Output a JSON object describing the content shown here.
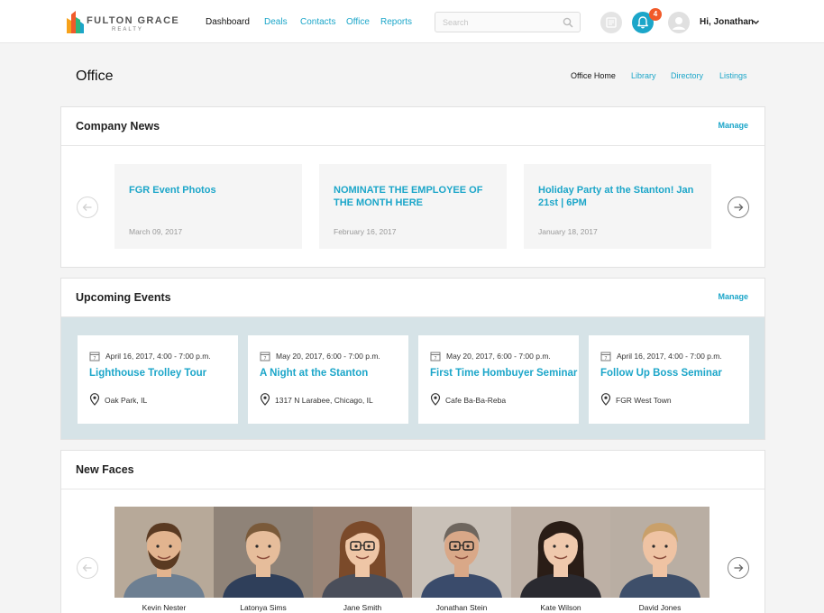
{
  "brand": {
    "name": "FULTON GRACE",
    "sub": "REALTY"
  },
  "nav": {
    "items": [
      {
        "label": "Dashboard",
        "active": true
      },
      {
        "label": "Deals",
        "active": false
      },
      {
        "label": "Contacts",
        "active": false
      },
      {
        "label": "Office",
        "active": false
      },
      {
        "label": "Reports",
        "active": false
      }
    ]
  },
  "search": {
    "placeholder": "Search",
    "value": ""
  },
  "notifications": {
    "count": "4"
  },
  "user": {
    "greeting": "Hi, Jonathan"
  },
  "page": {
    "title": "Office",
    "subnav": [
      {
        "label": "Office Home",
        "active": true
      },
      {
        "label": "Library",
        "active": false
      },
      {
        "label": "Directory",
        "active": false
      },
      {
        "label": "Listings",
        "active": false
      }
    ]
  },
  "company_news": {
    "title": "Company News",
    "manage_label": "Manage",
    "items": [
      {
        "title": "FGR Event Photos",
        "date": "March 09, 2017"
      },
      {
        "title": "NOMINATE THE EMPLOYEE OF THE MONTH HERE",
        "date": "February 16, 2017"
      },
      {
        "title": "Holiday Party at the Stanton! Jan 21st | 6PM",
        "date": "January 18, 2017"
      }
    ]
  },
  "upcoming_events": {
    "title": "Upcoming Events",
    "manage_label": "Manage",
    "items": [
      {
        "date": "April 16, 2017, 4:00 - 7:00 p.m.",
        "title": "Lighthouse Trolley Tour",
        "location": "Oak Park, IL"
      },
      {
        "date": "May 20, 2017, 6:00 - 7:00 p.m.",
        "title": "A Night at the Stanton",
        "location": "1317 N Larabee, Chicago, IL"
      },
      {
        "date": "May 20, 2017, 6:00 - 7:00 p.m.",
        "title": "First Time Hombuyer Seminar",
        "location": "Cafe Ba-Ba-Reba"
      },
      {
        "date": "April 16, 2017, 4:00 - 7:00 p.m.",
        "title": "Follow Up Boss Seminar",
        "location": "FGR West Town"
      }
    ]
  },
  "new_faces": {
    "title": "New Faces",
    "people": [
      {
        "name": "Kevin Nester",
        "hair": "#5a3a22",
        "skin": "#e2b48f",
        "bg": "#b7a999",
        "shirt": "#6d7f92"
      },
      {
        "name": "Latonya Sims",
        "hair": "#7a5a3a",
        "skin": "#e6bd9b",
        "bg": "#8f8378",
        "shirt": "#2f3f5a"
      },
      {
        "name": "Jane Smith",
        "hair": "#7b4a2a",
        "skin": "#efc6a6",
        "bg": "#9a8577",
        "shirt": "#4a4e5a"
      },
      {
        "name": "Jonathan Stein",
        "hair": "#6e665e",
        "skin": "#d9a888",
        "bg": "#c9c1b8",
        "shirt": "#3a4b6b"
      },
      {
        "name": "Kate Wilson",
        "hair": "#2a1d16",
        "skin": "#efc9ad",
        "bg": "#bdb0a5",
        "shirt": "#2a2a30"
      },
      {
        "name": "David Jones",
        "hair": "#c9a06a",
        "skin": "#efc3a3",
        "bg": "#b9aea3",
        "shirt": "#3e4f6a"
      }
    ]
  },
  "colors": {
    "accent": "#1ca6c9",
    "badge": "#f15a29",
    "events_band": "#d6e3e7"
  }
}
